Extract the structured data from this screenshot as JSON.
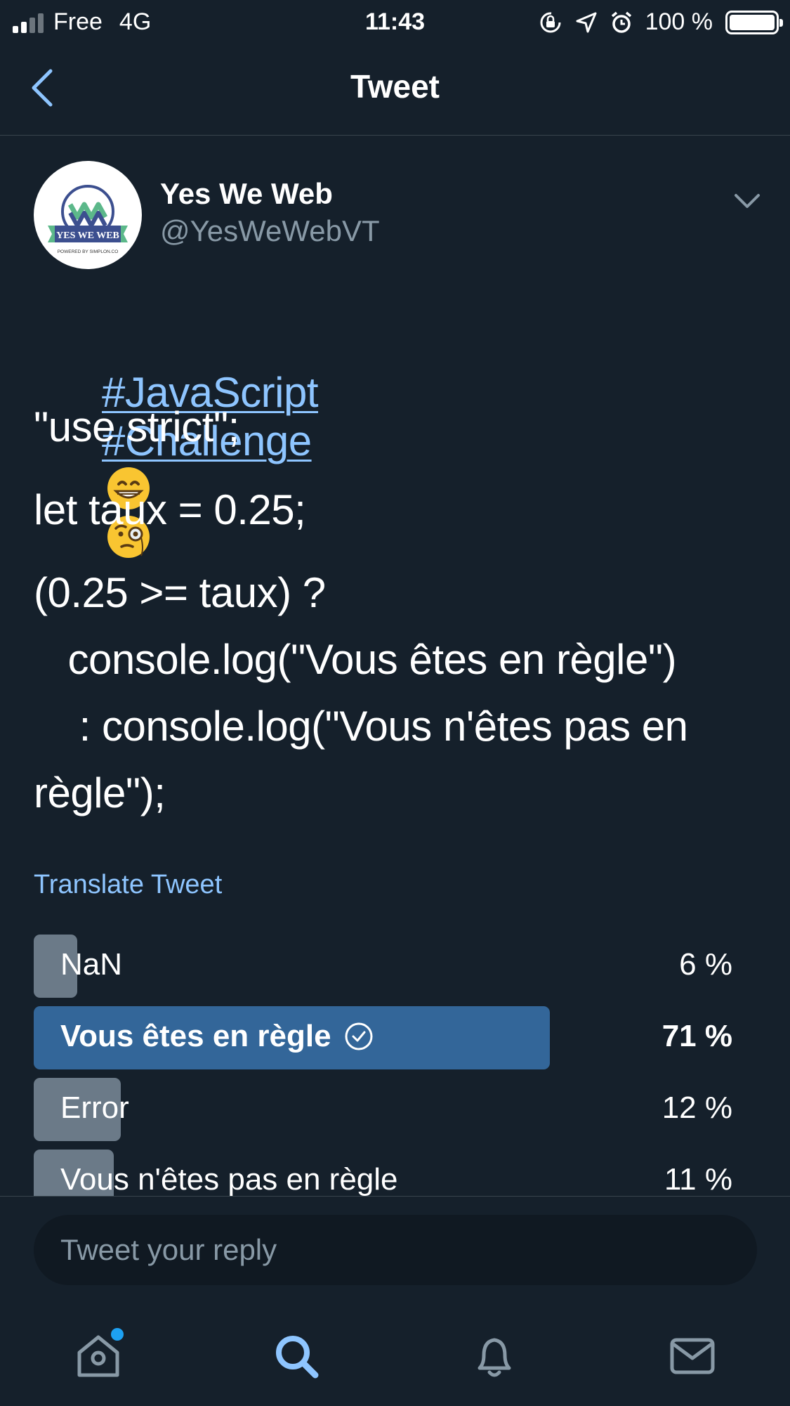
{
  "status_bar": {
    "carrier": "Free",
    "network": "4G",
    "time": "11:43",
    "battery": "100 %"
  },
  "header": {
    "title": "Tweet",
    "back_icon": "chevron-left-icon"
  },
  "tweet": {
    "author": {
      "name": "Yes We Web",
      "handle": "@YesWeWebVT",
      "avatar_text": "YES WE WEB",
      "avatar_subtext": "POWERED BY SIMPLON.CO"
    },
    "hashtags": [
      "#JavaScript",
      "#Challenge"
    ],
    "emojis": [
      "grinning-face-icon",
      "monocle-face-icon"
    ],
    "lines": [
      "\"use strict\";",
      "let taux = 0.25;",
      "(0.25 >= taux) ?",
      "   console.log(\"Vous êtes en règle\")",
      "    : console.log(\"Vous n'êtes pas en",
      "règle\");"
    ],
    "translate": "Translate Tweet"
  },
  "poll": {
    "options": [
      {
        "label": "NaN",
        "percent": "6 %",
        "share": 6,
        "winner": false
      },
      {
        "label": "Vous êtes en règle",
        "percent": "71 %",
        "share": 71,
        "winner": true
      },
      {
        "label": "Error",
        "percent": "12 %",
        "share": 12,
        "winner": false
      },
      {
        "label": "Vous n'êtes pas en règle",
        "percent": "11 %",
        "share": 11,
        "winner": false
      }
    ]
  },
  "reply": {
    "placeholder": "Tweet your reply"
  },
  "tabs": [
    {
      "name": "home",
      "icon": "home-icon",
      "has_notification": true
    },
    {
      "name": "search",
      "icon": "search-icon",
      "active": true
    },
    {
      "name": "notifications",
      "icon": "bell-icon"
    },
    {
      "name": "messages",
      "icon": "mail-icon"
    }
  ],
  "colors": {
    "background": "#15202b",
    "accent": "#8ec5ff",
    "winner_bar": "#336699",
    "loser_bar": "#6b7a88",
    "muted": "#8899a6"
  }
}
